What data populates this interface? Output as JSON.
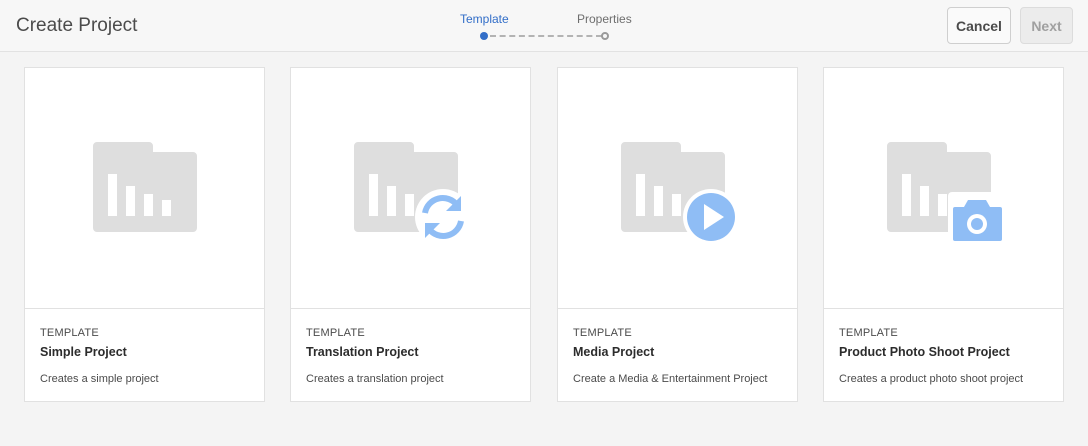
{
  "header": {
    "title": "Create Project",
    "steps": [
      {
        "label": "Template",
        "active": true
      },
      {
        "label": "Properties",
        "active": false
      }
    ],
    "cancel_label": "Cancel",
    "next_label": "Next"
  },
  "colors": {
    "accent": "#326ec8",
    "folder": "#dedede",
    "badge": "#8fbdf5"
  },
  "cards": [
    {
      "kind": "TEMPLATE",
      "name": "Simple Project",
      "description": "Creates a simple project",
      "badge_icon": "none"
    },
    {
      "kind": "TEMPLATE",
      "name": "Translation Project",
      "description": "Creates a translation project",
      "badge_icon": "refresh-icon"
    },
    {
      "kind": "TEMPLATE",
      "name": "Media Project",
      "description": "Create a Media & Entertainment Project",
      "badge_icon": "play-icon"
    },
    {
      "kind": "TEMPLATE",
      "name": "Product Photo Shoot Project",
      "description": "Creates a product photo shoot project",
      "badge_icon": "camera-icon"
    }
  ]
}
